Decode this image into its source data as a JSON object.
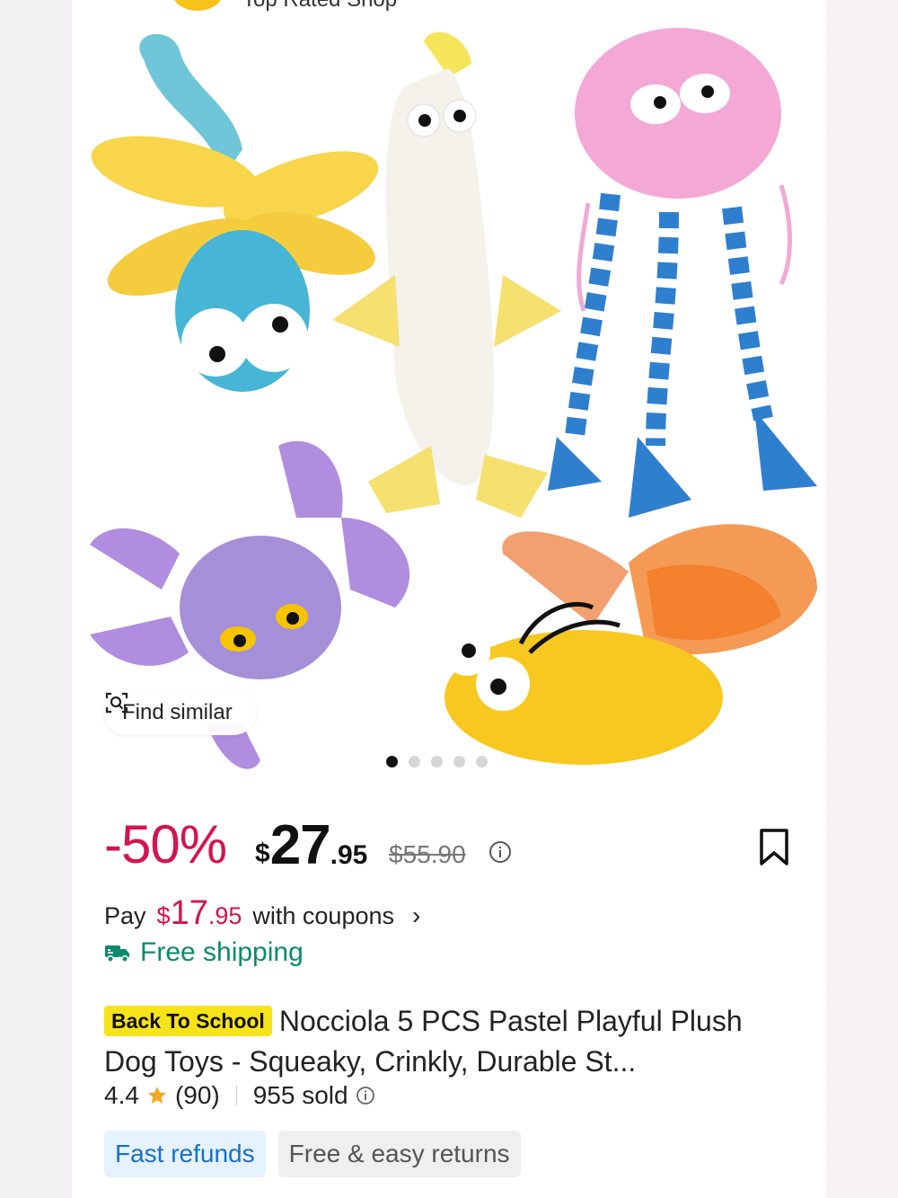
{
  "header": {
    "shop_name": "Top Rated Shop"
  },
  "gallery": {
    "find_similar_label": "Find similar",
    "image_count": 5,
    "active_index": 0
  },
  "price": {
    "discount": "-50%",
    "currency": "$",
    "integer": "27",
    "cents": ".95",
    "original": "$55.90"
  },
  "coupon": {
    "prefix": "Pay",
    "currency": "$",
    "integer": "17",
    "cents": ".95",
    "suffix": "with coupons"
  },
  "shipping": {
    "label": "Free shipping"
  },
  "product": {
    "badge": "Back To School",
    "title": "Nocciola 5 PCS Pastel Playful Plush Dog Toys - Squeaky, Crinkly, Durable St..."
  },
  "rating": {
    "score": "4.4",
    "count": "(90)",
    "sold": "955 sold"
  },
  "tags": [
    "Fast refunds",
    "Free & easy returns"
  ],
  "colors": {
    "discount": "#d31450",
    "shipping": "#0a8a6d",
    "badge_bg": "#f6e31a",
    "tag_blue": "#1670c9",
    "star": "#f5a623"
  },
  "icons": [
    "search-similar-icon",
    "info-icon",
    "bookmark-icon",
    "truck-icon",
    "star-icon",
    "chevron-right-icon"
  ]
}
